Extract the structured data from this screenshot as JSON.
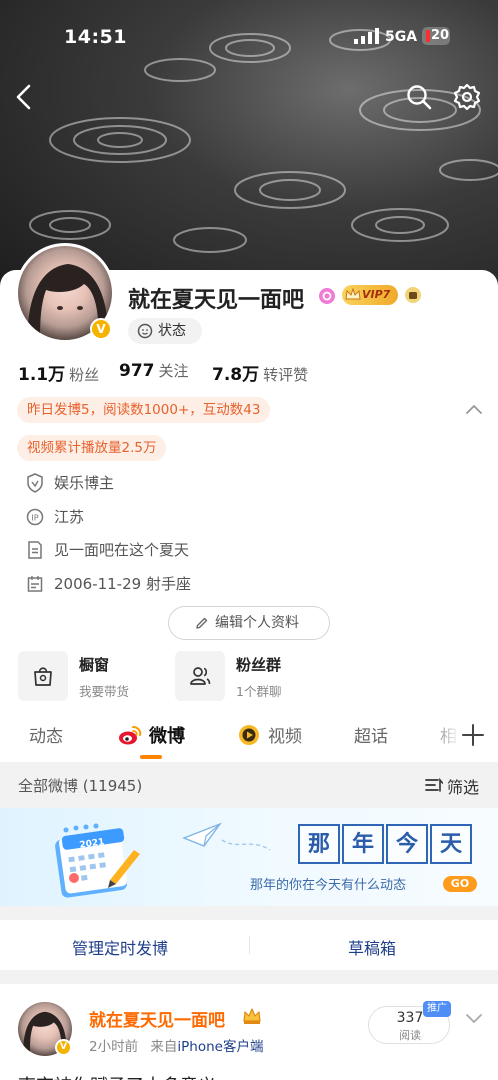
{
  "status_bar": {
    "time": "14:51",
    "network": "5GA",
    "battery": "20"
  },
  "profile": {
    "name": "就在夏天见一面吧",
    "vip_level": "VIP7",
    "status_label": "状态",
    "stats": [
      {
        "value": "1.1万",
        "label": "粉丝"
      },
      {
        "value": "977",
        "label": "关注"
      },
      {
        "value": "7.8万",
        "label": "转评赞"
      }
    ],
    "highlight": "昨日发博5，阅读数1000+，互动数43",
    "video_stat": "视频累计播放量2.5万",
    "info": [
      {
        "icon": "verified-shield-icon",
        "text": "娱乐博主"
      },
      {
        "icon": "ip-location-icon",
        "text": "江苏"
      },
      {
        "icon": "bio-document-icon",
        "text": "见一面吧在这个夏天"
      },
      {
        "icon": "calendar-icon",
        "text": "2006-11-29 射手座"
      }
    ],
    "edit_button": "编辑个人资料"
  },
  "shortcuts": [
    {
      "title": "橱窗",
      "subtitle": "我要带货",
      "icon": "shopping-bag-icon"
    },
    {
      "title": "粉丝群",
      "subtitle": "1个群聊",
      "icon": "fans-group-icon"
    }
  ],
  "tabs": [
    "动态",
    "微博",
    "视频",
    "超话",
    "相册"
  ],
  "active_tab": "微博",
  "all_posts": {
    "label": "全部微博 (11945)",
    "filter": "筛选"
  },
  "banner": {
    "year": "2021",
    "title_chars": [
      "那",
      "年",
      "今",
      "天"
    ],
    "subtitle": "那年的你在今天有什么动态",
    "go": "GO"
  },
  "actions": {
    "scheduled": "管理定时发博",
    "drafts": "草稿箱"
  },
  "post": {
    "author": "就在夏天见一面吧",
    "time": "2小时前",
    "from_prefix": "来自",
    "source": "iPhone客户端",
    "reads": "337",
    "reads_label": "阅读",
    "promo": "推广",
    "text_preview": "南京被你赋予了太多意义"
  },
  "colors": {
    "accent": "#ff8200",
    "highlight_bg": "#fdeee6",
    "highlight_text": "#e8622d",
    "link": "#1f3f8a"
  }
}
